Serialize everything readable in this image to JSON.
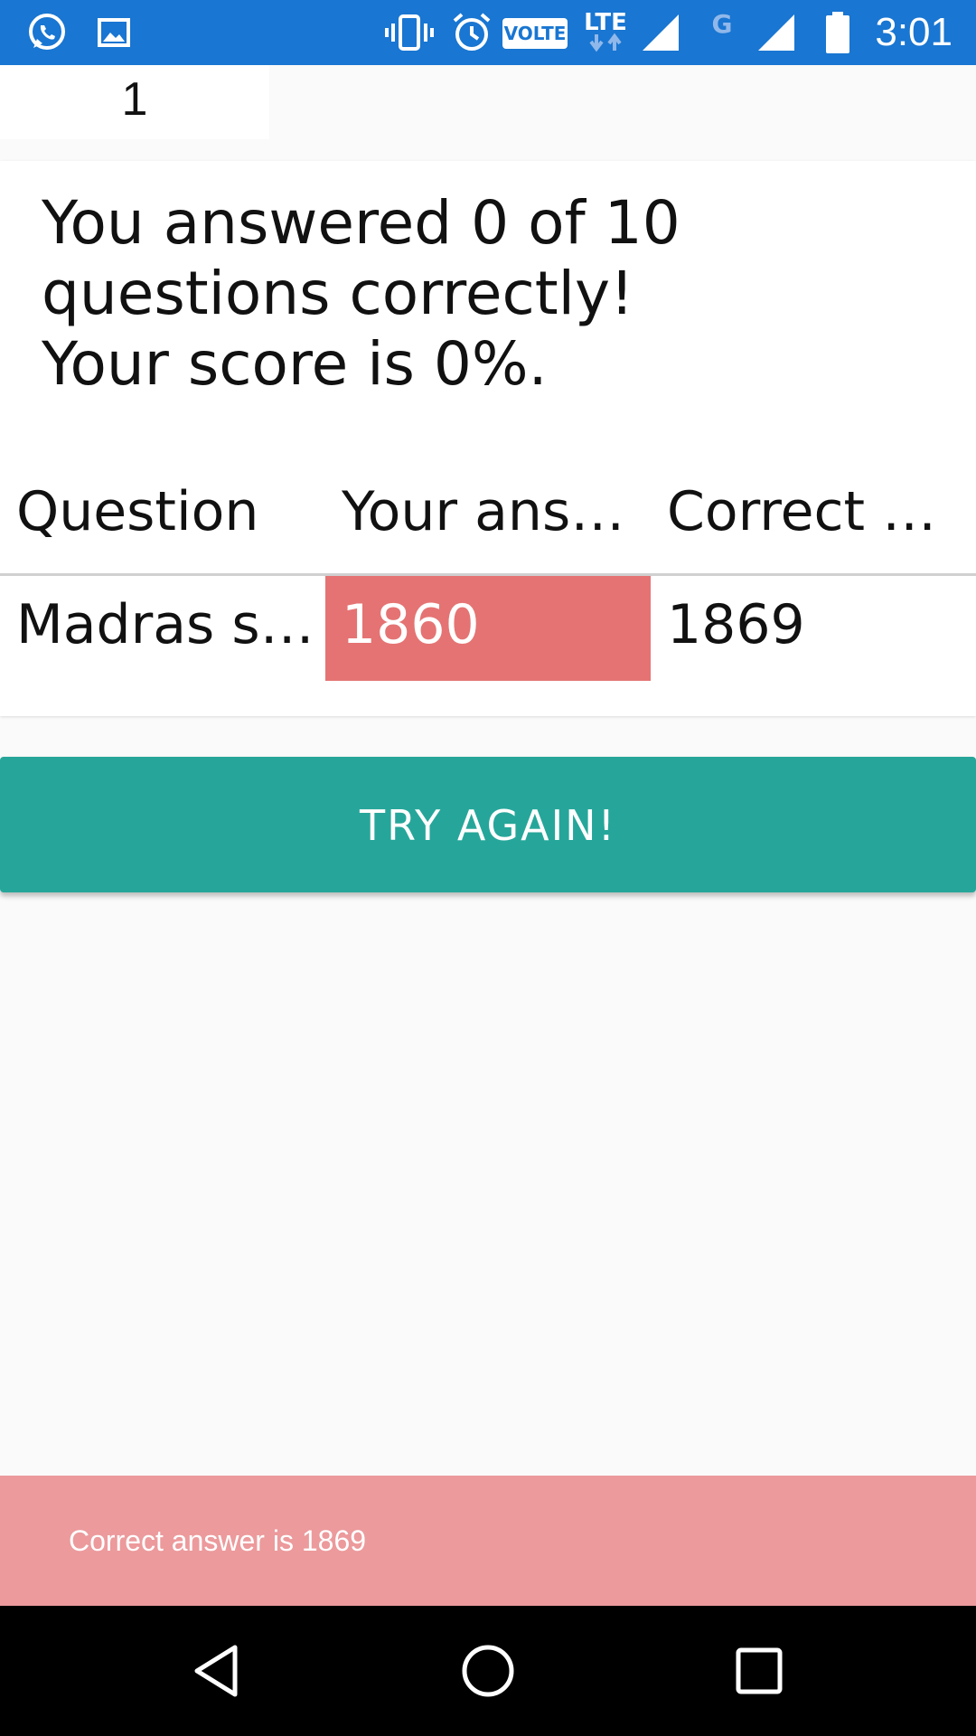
{
  "status_bar": {
    "time": "3:01",
    "volte": "VOLTE",
    "lte": "LTE",
    "g": "G",
    "icons": [
      "whatsapp-icon",
      "gallery-icon",
      "vibrate-icon",
      "alarm-icon",
      "volte-icon",
      "lte-icon",
      "signal-icon",
      "signal-icon",
      "battery-icon"
    ]
  },
  "page": {
    "number": "1"
  },
  "results": {
    "line1": "You answered 0 of 10",
    "line2": "questions correctly!",
    "line3": "Your score is 0%."
  },
  "table": {
    "headers": [
      "Question",
      "Your ans…",
      "Correct a…"
    ],
    "rows": [
      {
        "question": "Madras st…",
        "your_answer": "1860",
        "correct_answer": "1869"
      }
    ]
  },
  "button": {
    "try_again": "TRY AGAIN!"
  },
  "toast": {
    "message": "Correct answer is 1869"
  },
  "colors": {
    "status_bar": "#1976d2",
    "wrong_answer": "#e57373",
    "button": "#26a69a",
    "toast": "#ec9a9c"
  },
  "nav": {
    "icons": [
      "back-icon",
      "home-icon",
      "recents-icon"
    ]
  }
}
